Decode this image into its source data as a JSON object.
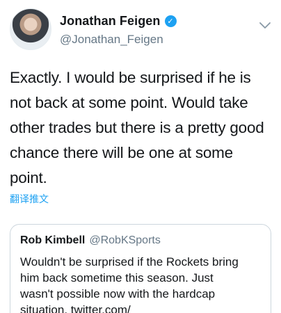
{
  "author": {
    "display_name": "Jonathan Feigen",
    "handle": "@Jonathan_Feigen",
    "verified_icon": "verified-badge-icon"
  },
  "tweet": {
    "text": "Exactly. I would be surprised if he is not back at some point. Would take other trades but there is a pretty good chance there will be one at some point."
  },
  "translate_label": "翻译推文",
  "quoted_tweet": {
    "display_name": "Rob Kimbell",
    "handle": "@RobKSports",
    "text": "Wouldn't be surprised if the Rockets bring him back sometime this season. Just wasn't possible now with the hardcap situation. twitter.com/"
  },
  "colors": {
    "accent": "#1da1f2",
    "secondary_text": "#657786",
    "border": "#ccd6dd"
  }
}
